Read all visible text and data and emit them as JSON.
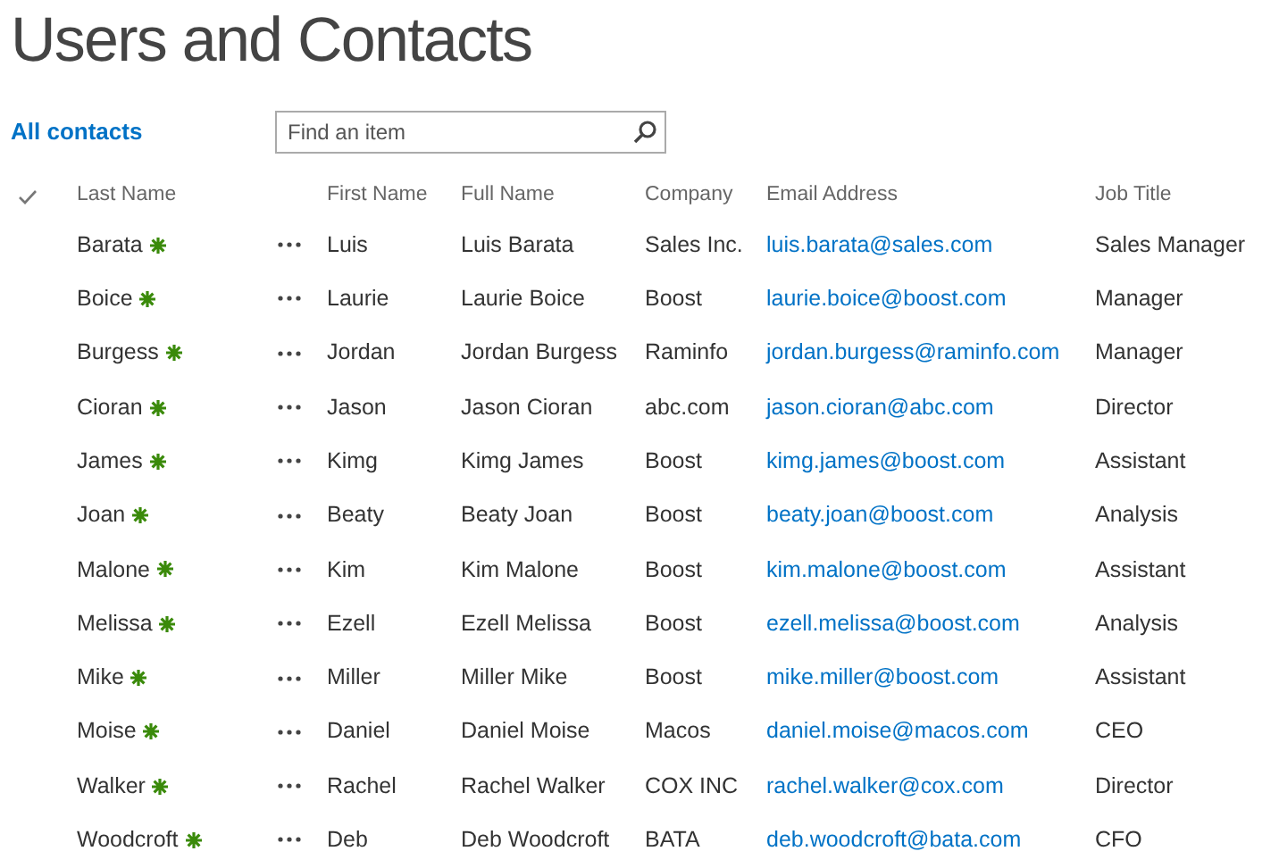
{
  "title": "Users and Contacts",
  "view": {
    "label": "All contacts",
    "selected": true
  },
  "search": {
    "placeholder": "Find an item"
  },
  "columns": [
    "Last Name",
    "First Name",
    "Full Name",
    "Company",
    "Email Address",
    "Job Title"
  ],
  "rows": [
    {
      "last_name": "Barata",
      "is_new": true,
      "first_name": "Luis",
      "full_name": "Luis Barata",
      "company": "Sales Inc.",
      "email": "luis.barata@sales.com",
      "job_title": "Sales Manager"
    },
    {
      "last_name": "Boice",
      "is_new": true,
      "first_name": "Laurie",
      "full_name": "Laurie Boice",
      "company": "Boost",
      "email": "laurie.boice@boost.com",
      "job_title": "Manager"
    },
    {
      "last_name": "Burgess",
      "is_new": true,
      "first_name": "Jordan",
      "full_name": "Jordan Burgess",
      "company": "Raminfo",
      "email": "jordan.burgess@raminfo.com",
      "job_title": "Manager"
    },
    {
      "last_name": "Cioran",
      "is_new": true,
      "first_name": "Jason",
      "full_name": "Jason Cioran",
      "company": "abc.com",
      "email": "jason.cioran@abc.com",
      "job_title": "Director"
    },
    {
      "last_name": "James",
      "is_new": true,
      "first_name": "Kimg",
      "full_name": "Kimg James",
      "company": "Boost",
      "email": "kimg.james@boost.com",
      "job_title": "Assistant"
    },
    {
      "last_name": "Joan",
      "is_new": true,
      "first_name": "Beaty",
      "full_name": "Beaty Joan",
      "company": "Boost",
      "email": "beaty.joan@boost.com",
      "job_title": "Analysis"
    },
    {
      "last_name": "Malone",
      "is_new": true,
      "first_name": "Kim",
      "full_name": "Kim Malone",
      "company": "Boost",
      "email": "kim.malone@boost.com",
      "job_title": "Assistant"
    },
    {
      "last_name": "Melissa",
      "is_new": true,
      "first_name": "Ezell",
      "full_name": "Ezell Melissa",
      "company": "Boost",
      "email": "ezell.melissa@boost.com",
      "job_title": "Analysis"
    },
    {
      "last_name": "Mike",
      "is_new": true,
      "first_name": "Miller",
      "full_name": "Miller Mike",
      "company": "Boost",
      "email": "mike.miller@boost.com",
      "job_title": "Assistant"
    },
    {
      "last_name": "Moise",
      "is_new": true,
      "first_name": "Daniel",
      "full_name": "Daniel Moise",
      "company": "Macos",
      "email": "daniel.moise@macos.com",
      "job_title": "CEO"
    },
    {
      "last_name": "Walker",
      "is_new": true,
      "first_name": "Rachel",
      "full_name": "Rachel Walker",
      "company": "COX INC",
      "email": "rachel.walker@cox.com",
      "job_title": "Director"
    },
    {
      "last_name": "Woodcroft",
      "is_new": true,
      "first_name": "Deb",
      "full_name": "Deb Woodcroft",
      "company": "BATA",
      "email": "deb.woodcroft@bata.com",
      "job_title": "CFO"
    }
  ]
}
